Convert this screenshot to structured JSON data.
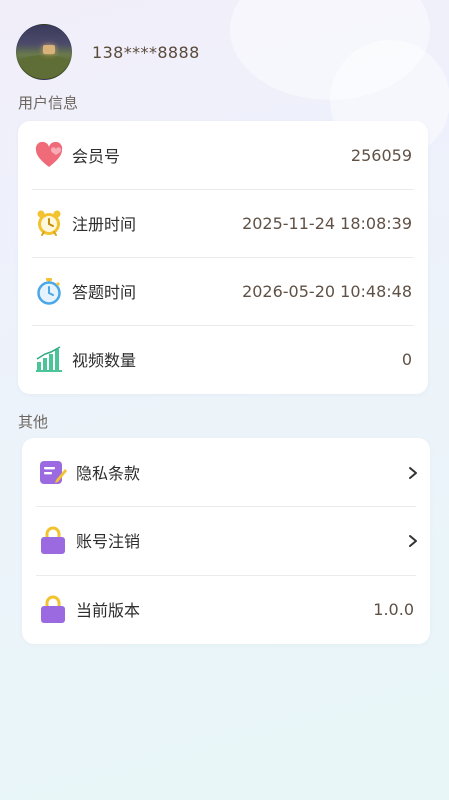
{
  "user": {
    "phone": "138****8888"
  },
  "sections": {
    "user_info": {
      "title": "用户信息",
      "rows": [
        {
          "label": "会员号",
          "value": "256059",
          "icon": "heart-icon"
        },
        {
          "label": "注册时间",
          "value": "2025-11-24 18:08:39",
          "icon": "alarm-clock-icon"
        },
        {
          "label": "答题时间",
          "value": "2026-05-20 10:48:48",
          "icon": "stopwatch-icon"
        },
        {
          "label": "视频数量",
          "value": "0",
          "icon": "bar-chart-icon"
        }
      ]
    },
    "other": {
      "title": "其他",
      "rows": [
        {
          "label": "隐私条款",
          "icon": "document-edit-icon",
          "chevron": true
        },
        {
          "label": "账号注销",
          "icon": "lock-icon",
          "chevron": true
        },
        {
          "label": "当前版本",
          "value": "1.0.0",
          "icon": "lock-icon"
        }
      ]
    }
  },
  "colors": {
    "heart": "#ef6b7a",
    "clock": "#f2c230",
    "stopwatch": "#4aa7e8",
    "chart": "#4cc49a",
    "purple": "#9b6ae0"
  }
}
